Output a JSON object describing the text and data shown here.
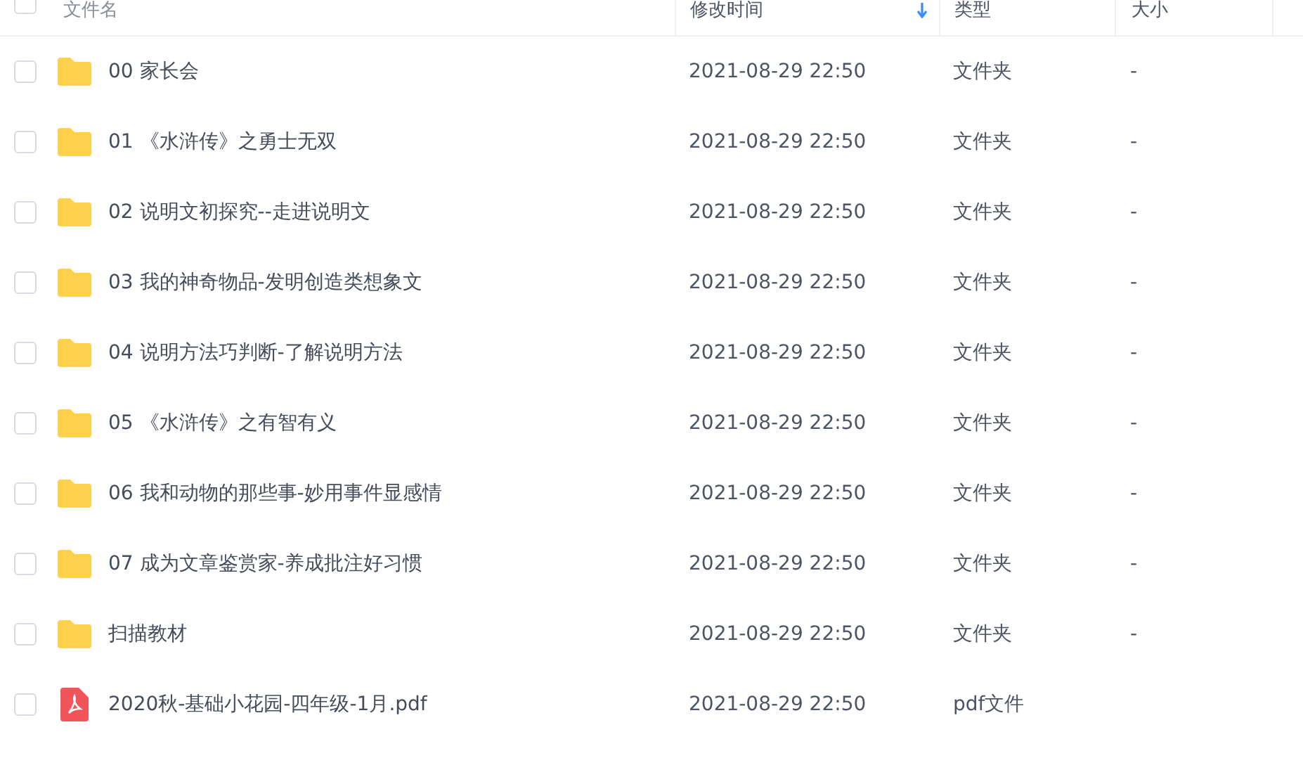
{
  "header": {
    "select_all_checked": false,
    "columns": [
      {
        "label": "文件名"
      },
      {
        "label": "修改时间",
        "sorted": true
      },
      {
        "label": "类型"
      },
      {
        "label": "大小"
      }
    ]
  },
  "rows": [
    {
      "kind": "folder",
      "name": "00 家长会",
      "modified": "2021-08-29 22:50",
      "type": "文件夹",
      "size": "-",
      "checked": false
    },
    {
      "kind": "folder",
      "name": "01 《水浒传》之勇士无双",
      "modified": "2021-08-29 22:50",
      "type": "文件夹",
      "size": "-",
      "checked": false
    },
    {
      "kind": "folder",
      "name": "02 说明文初探究--走进说明文",
      "modified": "2021-08-29 22:50",
      "type": "文件夹",
      "size": "-",
      "checked": false
    },
    {
      "kind": "folder",
      "name": "03 我的神奇物品-发明创造类想象文",
      "modified": "2021-08-29 22:50",
      "type": "文件夹",
      "size": "-",
      "checked": false
    },
    {
      "kind": "folder",
      "name": "04 说明方法巧判断-了解说明方法",
      "modified": "2021-08-29 22:50",
      "type": "文件夹",
      "size": "-",
      "checked": false
    },
    {
      "kind": "folder",
      "name": "05 《水浒传》之有智有义",
      "modified": "2021-08-29 22:50",
      "type": "文件夹",
      "size": "-",
      "checked": false
    },
    {
      "kind": "folder",
      "name": "06 我和动物的那些事-妙用事件显感情",
      "modified": "2021-08-29 22:50",
      "type": "文件夹",
      "size": "-",
      "checked": false
    },
    {
      "kind": "folder",
      "name": "07 成为文章鉴赏家-养成批注好习惯",
      "modified": "2021-08-29 22:50",
      "type": "文件夹",
      "size": "-",
      "checked": false
    },
    {
      "kind": "folder",
      "name": "扫描教材",
      "modified": "2021-08-29 22:50",
      "type": "文件夹",
      "size": "-",
      "checked": false
    },
    {
      "kind": "pdf",
      "name": "2020秋-基础小花园-四年级-1月.pdf",
      "modified": "2021-08-29 22:50",
      "type": "pdf文件",
      "checked": false
    }
  ]
}
